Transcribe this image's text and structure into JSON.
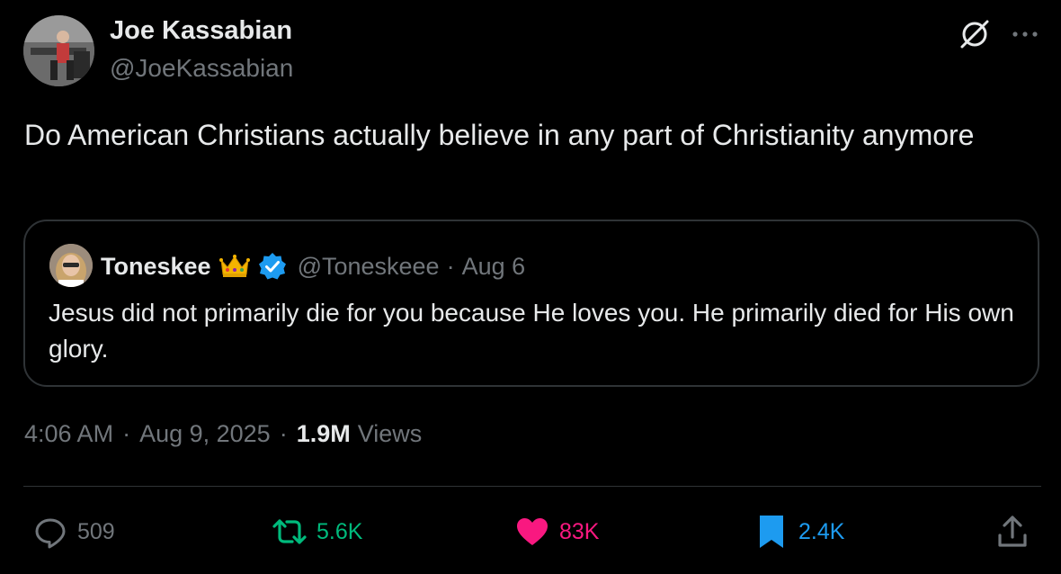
{
  "author": {
    "name": "Joe Kassabian",
    "handle": "@JoeKassabian",
    "avatar_icon": "user-avatar"
  },
  "header_icons": [
    "grok-icon",
    "more-icon"
  ],
  "tweet_text": "Do American Christians actually believe in any part of Christianity anymore",
  "quote": {
    "name": "Toneskee",
    "badge_icons": [
      "crown-emoji-icon",
      "verified-badge-icon"
    ],
    "handle": "@Toneskeee",
    "separator": "·",
    "date": "Aug 6",
    "text": "Jesus did not primarily die for you because He loves you. He primarily died for His own glory."
  },
  "meta": {
    "time": "4:06 AM",
    "separator": "·",
    "date": "Aug 9, 2025",
    "views_count": "1.9M",
    "views_label": "Views"
  },
  "actions": {
    "replies": "509",
    "retweets": "5.6K",
    "likes": "83K",
    "bookmarks": "2.4K"
  },
  "colors": {
    "background": "#000000",
    "text": "#e7e9ea",
    "muted": "#71767b",
    "border": "#2f3336",
    "retweet": "#00ba7c",
    "like": "#f91880",
    "bookmark": "#1d9bf0"
  }
}
